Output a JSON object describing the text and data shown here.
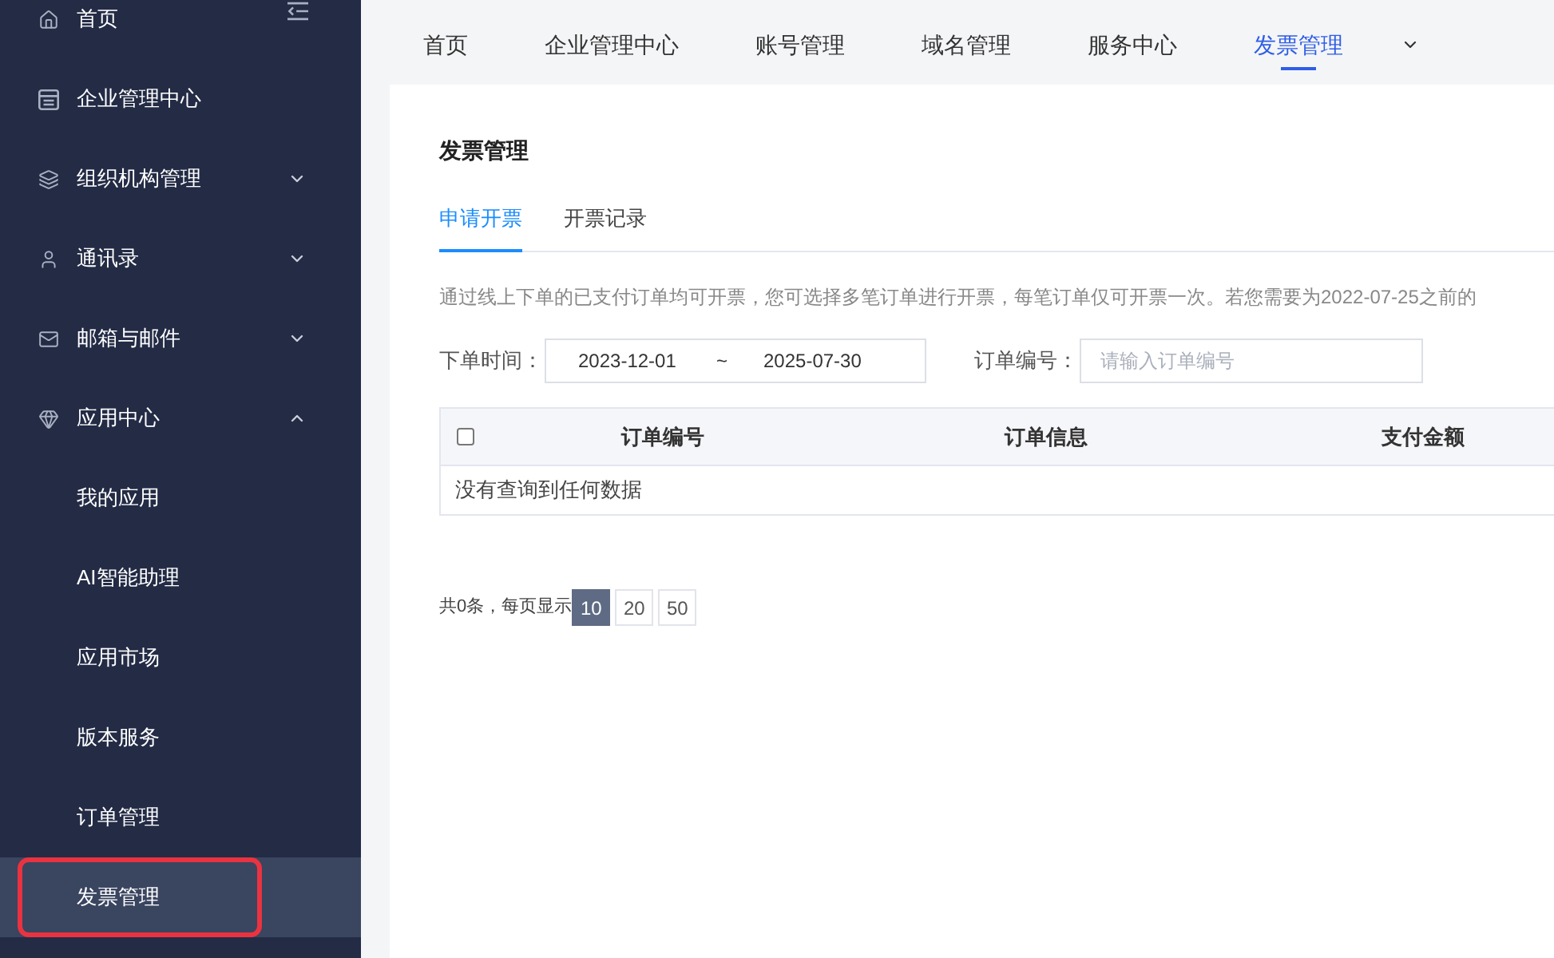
{
  "sidebar": {
    "items": [
      {
        "label": "首页",
        "kind": "link",
        "selected": false
      },
      {
        "label": "企业管理中心",
        "kind": "link",
        "selected": false
      },
      {
        "label": "组织机构管理",
        "kind": "group",
        "selected": false,
        "expanded": false
      },
      {
        "label": "通讯录",
        "kind": "group",
        "selected": false,
        "expanded": false
      },
      {
        "label": "邮箱与邮件",
        "kind": "group",
        "selected": false,
        "expanded": false
      },
      {
        "label": "应用中心",
        "kind": "group",
        "selected": false,
        "expanded": true,
        "children": [
          {
            "label": "我的应用",
            "selected": false,
            "highlighted": false
          },
          {
            "label": "AI智能助理",
            "selected": false,
            "highlighted": false
          },
          {
            "label": "应用市场",
            "selected": false,
            "highlighted": false
          },
          {
            "label": "版本服务",
            "selected": false,
            "highlighted": false
          },
          {
            "label": "订单管理",
            "selected": false,
            "highlighted": false
          },
          {
            "label": "发票管理",
            "selected": true,
            "highlighted": true
          }
        ]
      }
    ]
  },
  "top_nav": {
    "tabs": [
      {
        "label": "首页",
        "selected": false
      },
      {
        "label": "企业管理中心",
        "selected": false
      },
      {
        "label": "账号管理",
        "selected": false
      },
      {
        "label": "域名管理",
        "selected": false
      },
      {
        "label": "服务中心",
        "selected": false
      },
      {
        "label": "发票管理",
        "selected": true
      }
    ]
  },
  "content": {
    "title": "发票管理",
    "tabs": [
      {
        "label": "申请开票",
        "selected": true
      },
      {
        "label": "开票记录",
        "selected": false
      }
    ],
    "notice": "通过线上下单的已支付订单均可开票，您可选择多笔订单进行开票，每笔订单仅可开票一次。若您需要为2022-07-25之前的",
    "filters": [
      {
        "kind": "date_range",
        "label": "下单时间：",
        "start": "2023-12-01",
        "separator": "~",
        "end": "2025-07-30"
      },
      {
        "kind": "text",
        "label": "订单编号：",
        "placeholder": "请输入订单编号"
      }
    ],
    "table": {
      "select_all_checked": false,
      "columns": [
        "订单编号",
        "订单信息",
        "支付金额"
      ],
      "empty_text": "没有查询到任何数据"
    },
    "pagination": {
      "summary": "共0条，每页显示",
      "page_sizes": [
        {
          "label": "10",
          "selected": true
        },
        {
          "label": "20",
          "selected": false
        },
        {
          "label": "50",
          "selected": false
        }
      ]
    }
  }
}
